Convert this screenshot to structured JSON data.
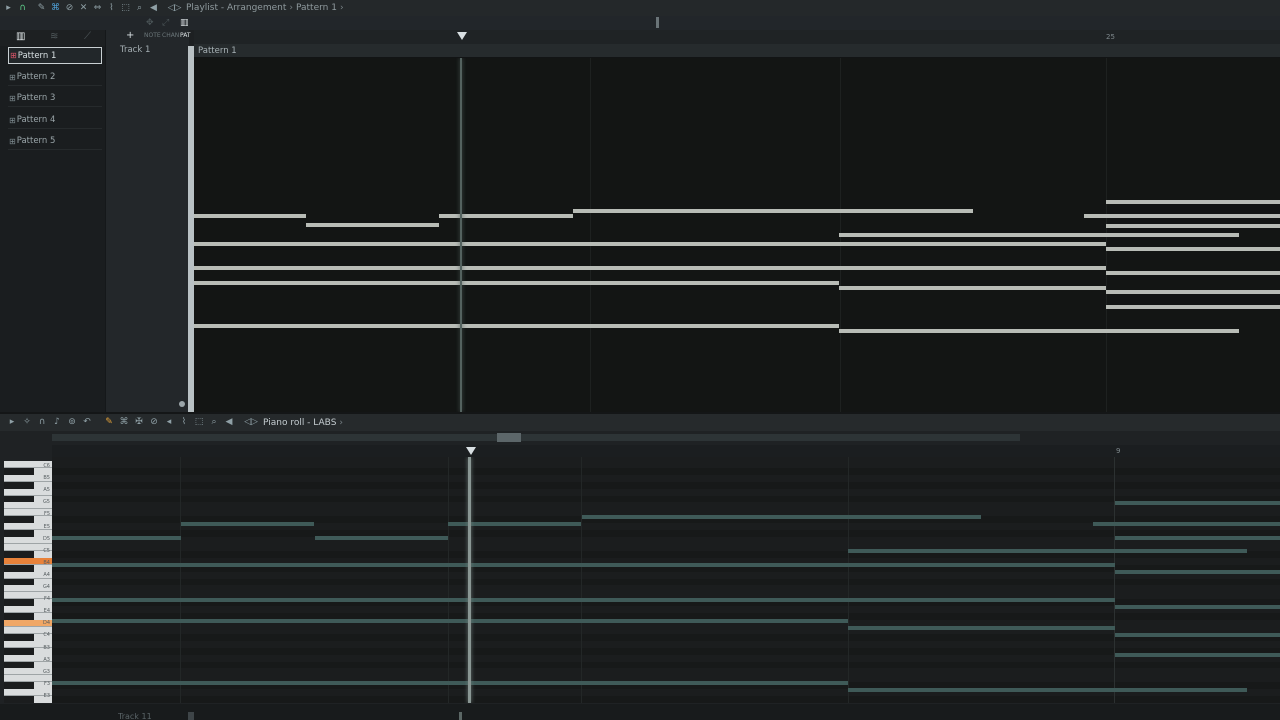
{
  "playlist": {
    "title": "Playlist - Arrangement",
    "pattern_crumb": "Pattern 1",
    "patterns": [
      "Pattern 1",
      "Pattern 2",
      "Pattern 3",
      "Pattern 4",
      "Pattern 5"
    ],
    "selected_pattern": "Pattern 1",
    "track_label": "Track 1",
    "clip_label": "Pattern 1",
    "bar_marker": "25",
    "view_buttons": [
      "NOTE",
      "CHAN",
      "PAT"
    ]
  },
  "piano_roll": {
    "title": "Piano roll - LABS",
    "bar_marker": "9",
    "key_labels": [
      "C6",
      "B5",
      "A5",
      "G5",
      "F5",
      "E5",
      "D5",
      "C5",
      "B4",
      "A4",
      "G4",
      "F4",
      "E4",
      "D4",
      "C4",
      "B3",
      "A3",
      "G3",
      "F3",
      "E3"
    ]
  },
  "bottom": {
    "track_label": "Track 11"
  },
  "colors": {
    "playlist_note": "#b8bcb6",
    "piano_note": "#3f5a58",
    "highlight_key": "#e8823a",
    "background": "#131514"
  }
}
